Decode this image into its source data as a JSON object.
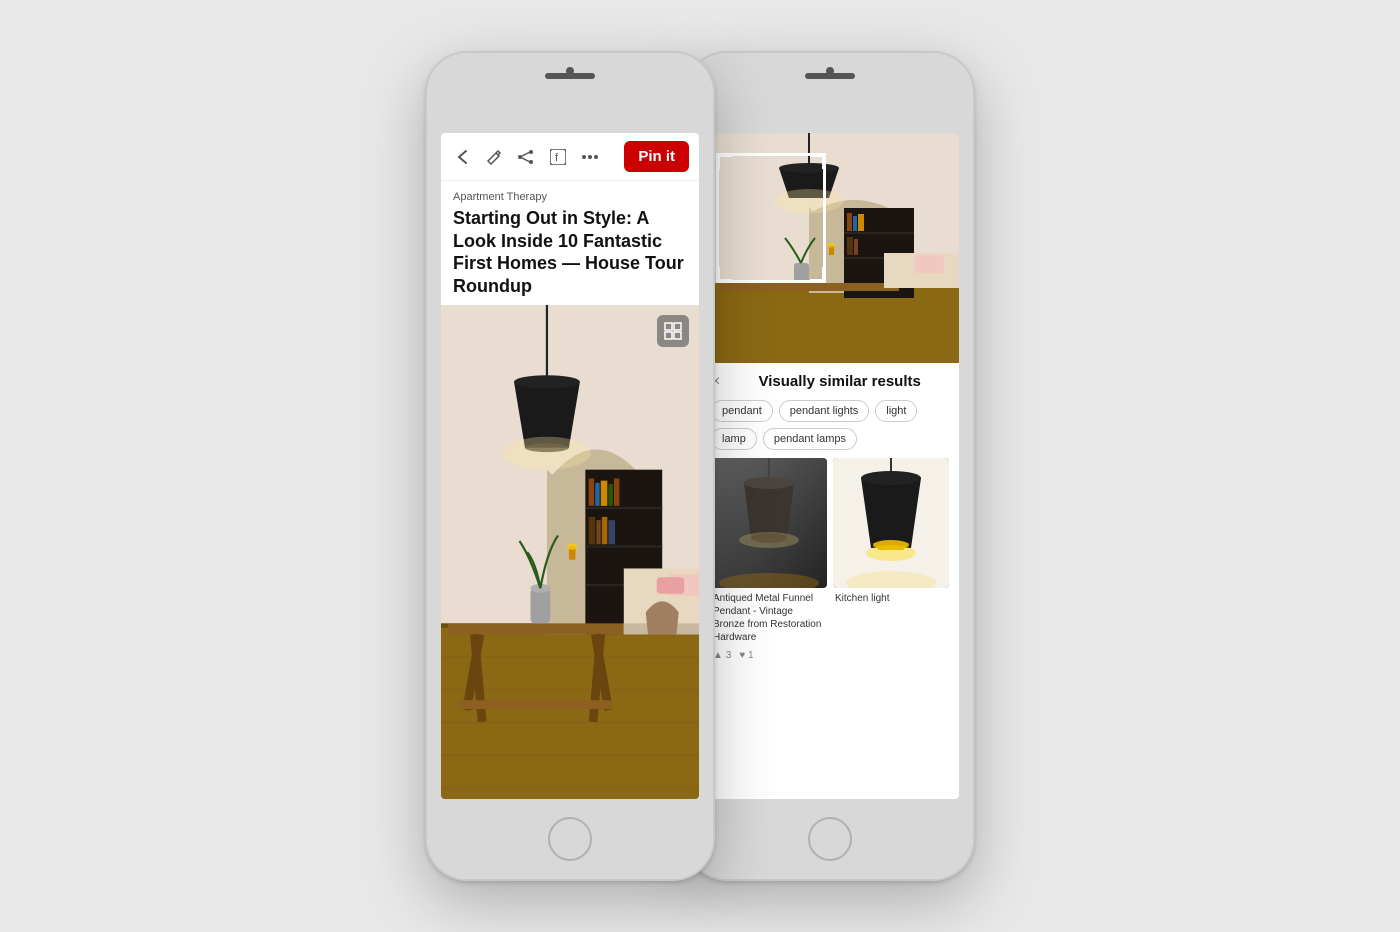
{
  "phones": {
    "left": {
      "toolbar": {
        "back_icon": "←",
        "edit_icon": "✏",
        "share_icon": "➤",
        "facebook_icon": "f",
        "more_icon": "•••",
        "pin_it_label": "Pin it"
      },
      "article": {
        "source": "Apartment Therapy",
        "title": "Starting Out in Style: A Look Inside 10 Fantastic First Homes — House Tour Roundup"
      },
      "visual_search_icon": "⊡"
    },
    "right": {
      "similar_results": {
        "title": "Visually similar results",
        "close_icon": "×",
        "tags": [
          "pendant",
          "pendant lights",
          "light",
          "lamp",
          "pendant lamps"
        ]
      },
      "results": [
        {
          "title": "Antiqued Metal Funnel Pendant - Vintage Bronze from Restoration Hardware",
          "likes": "3",
          "hearts": "1"
        },
        {
          "title": "Kitchen light",
          "likes": "",
          "hearts": ""
        }
      ]
    }
  }
}
